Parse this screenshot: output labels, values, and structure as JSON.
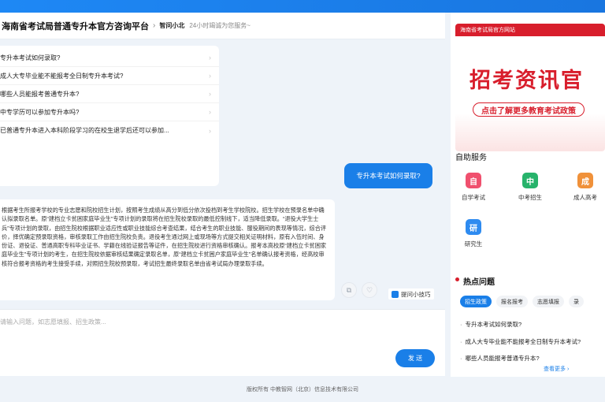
{
  "header": {
    "title": "海南省考试局普通专升本官方咨询平台",
    "separator": "›",
    "badge": "智问小北",
    "service": "24小时竭诚为您服务~"
  },
  "chat": {
    "faq": [
      "专升本考试如何录取?",
      "成人大专毕业能不能报考全日制专升本考试?",
      "哪些人员能报考普通专升本?",
      "中专学历可以参加专升本吗?",
      "已普通专升本进入本科阶段学习的在校生退学后还可以参加..."
    ],
    "faq_arrow": "›",
    "user_message": "专升本考试如何录取?",
    "answer": "根据考生所报考学校的专业志愿和院校招生计划，按照考生成绩从高分到低分依次投档到考生学校院校。招生学校在预录名单中确认拟录取名单。原“建档立卡贫困家庭毕业生”专项计划的录取将在招生院校录取的最低控制线下，适当降低录取。“退役大学生士兵”专项计划的录取，由招生院校根据职业适应性或职业技能综合考查结果，结合考生的职业技能、服役期间的表现等情况，综合评价，择优确定预录取资格，审核录取工作由招生院校负责。退役考生通过网上或现场等方式提交相关证明材料，原有入伍时间、身份证、退役证、普通高职专科毕业证书、学籍在线验证报告等证件，在招生院校进行资格审核确认。报考本高校原“建档立卡贫困家庭毕业生”专项计划的考生，在招生院校依据审核结果确定录取名单，原“建档立卡贫困户家庭毕业生”名单确认报考资格，经高校审核符合报考资格的考生接受手续，对照招生院校预录取，考试招生最终录取名单由省考试局办理录取手续。",
    "tips_label": "提问小技巧",
    "input_placeholder": "请输入问题，如志愿填报、招生政策...",
    "send_label": "发 送"
  },
  "footer": {
    "copyright": "版权所有 中教智网（北京）信息技术有限公司"
  },
  "sidebar": {
    "banner": {
      "tag": "海南省考试局官方网站",
      "headline": "招考资讯官",
      "subline": "点击了解更多教育考试政策"
    },
    "services_title": "自助服务",
    "services": [
      {
        "label": "自学考试",
        "icon": "book-icon",
        "color": "#f0506e",
        "glyph": "自"
      },
      {
        "label": "中考招生",
        "icon": "users-icon",
        "color": "#27b36b",
        "glyph": "中"
      },
      {
        "label": "成人高考",
        "icon": "graduation-icon",
        "color": "#f0913a",
        "glyph": "成"
      },
      {
        "label": "研究生",
        "icon": "graduate-icon",
        "color": "#2e8bf0",
        "glyph": "研"
      }
    ],
    "hot_title": "热点问题",
    "hot_tabs": [
      "招生政策",
      "报名报考",
      "志愿填报",
      "录"
    ],
    "hot_questions": [
      "专升本考试如何录取?",
      "成人大专毕业能不能报考全日制专升本考试?",
      "哪些人员能报考普通专升本?"
    ],
    "more_label": "查看更多 ›"
  }
}
